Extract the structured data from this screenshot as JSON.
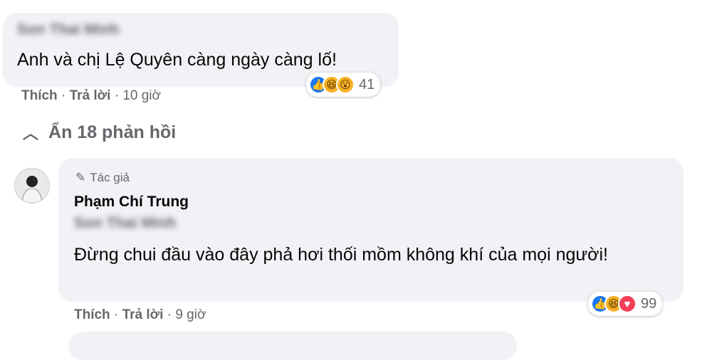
{
  "comment1": {
    "author": "Son Thai Minh",
    "text": "Anh và chị Lệ Quyên càng ngày càng lố!",
    "reaction_count": "41",
    "actions": {
      "like": "Thích",
      "reply": "Trả lời",
      "time": "10 giờ"
    }
  },
  "replies_toggle": {
    "label": "Ẩn 18 phản hồi"
  },
  "reply1": {
    "badge": "Tác giả",
    "author": "Phạm Chí Trung",
    "mention": "Son Thai Minh",
    "text": "Đừng chui đầu vào đây phả hơi thối mồm không khí của mọi người!",
    "reaction_count": "99",
    "actions": {
      "like": "Thích",
      "reply": "Trả lời",
      "time": "9 giờ"
    }
  },
  "colors": {
    "bubble": "#f0f2f5",
    "muted": "#65676b",
    "like": "#1877f2",
    "haha": "#f7b125",
    "love": "#f33e58"
  },
  "icons": [
    "like-icon",
    "haha-icon",
    "wow-icon",
    "love-icon",
    "pen-icon",
    "chevron-up-icon"
  ]
}
